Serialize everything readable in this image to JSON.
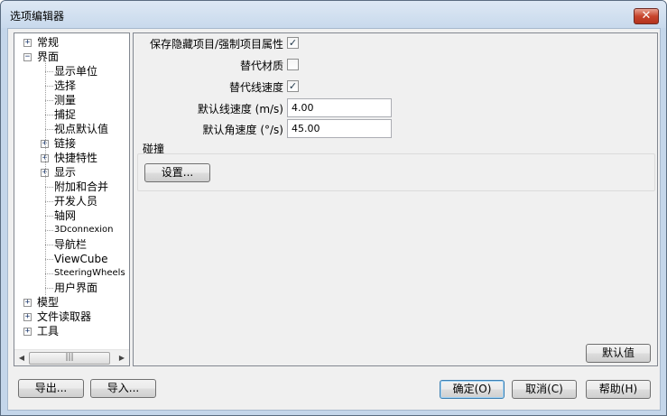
{
  "window": {
    "title": "选项编辑器",
    "close_symbol": "✕"
  },
  "tree": {
    "items": [
      {
        "label": "常规",
        "expander": "+"
      },
      {
        "label": "界面",
        "expander": "−"
      },
      {
        "label": "显示单位"
      },
      {
        "label": "选择"
      },
      {
        "label": "测量"
      },
      {
        "label": "捕捉"
      },
      {
        "label": "视点默认值"
      },
      {
        "label": "链接",
        "expander": "+"
      },
      {
        "label": "快捷特性",
        "expander": "+"
      },
      {
        "label": "显示",
        "expander": "+"
      },
      {
        "label": "附加和合并"
      },
      {
        "label": "开发人员"
      },
      {
        "label": "轴网"
      },
      {
        "label": "3Dconnexion"
      },
      {
        "label": "导航栏"
      },
      {
        "label": "ViewCube"
      },
      {
        "label": "SteeringWheels"
      },
      {
        "label": "用户界面"
      },
      {
        "label": "模型",
        "expander": "+"
      },
      {
        "label": "文件读取器",
        "expander": "+"
      },
      {
        "label": "工具",
        "expander": "+"
      }
    ],
    "scroll_left": "◀",
    "scroll_right": "▶",
    "scroll_grip": "|||"
  },
  "properties": {
    "save_hidden_label": "保存隐藏项目/强制项目属性",
    "save_hidden_checked": true,
    "override_material_label": "替代材质",
    "override_material_checked": false,
    "override_linear_speed_label": "替代线速度",
    "override_linear_speed_checked": true,
    "default_linear_speed_label": "默认线速度 (m/s)",
    "default_linear_speed_value": "4.00",
    "default_angular_speed_label": "默认角速度 (°/s)",
    "default_angular_speed_value": "45.00",
    "collision_group_label": "碰撞",
    "settings_button": "设置...",
    "check_mark": "✓"
  },
  "buttons": {
    "defaults": "默认值",
    "export": "导出...",
    "import": "导入...",
    "ok": "确定(O)",
    "cancel": "取消(C)",
    "help": "帮助(H)"
  }
}
